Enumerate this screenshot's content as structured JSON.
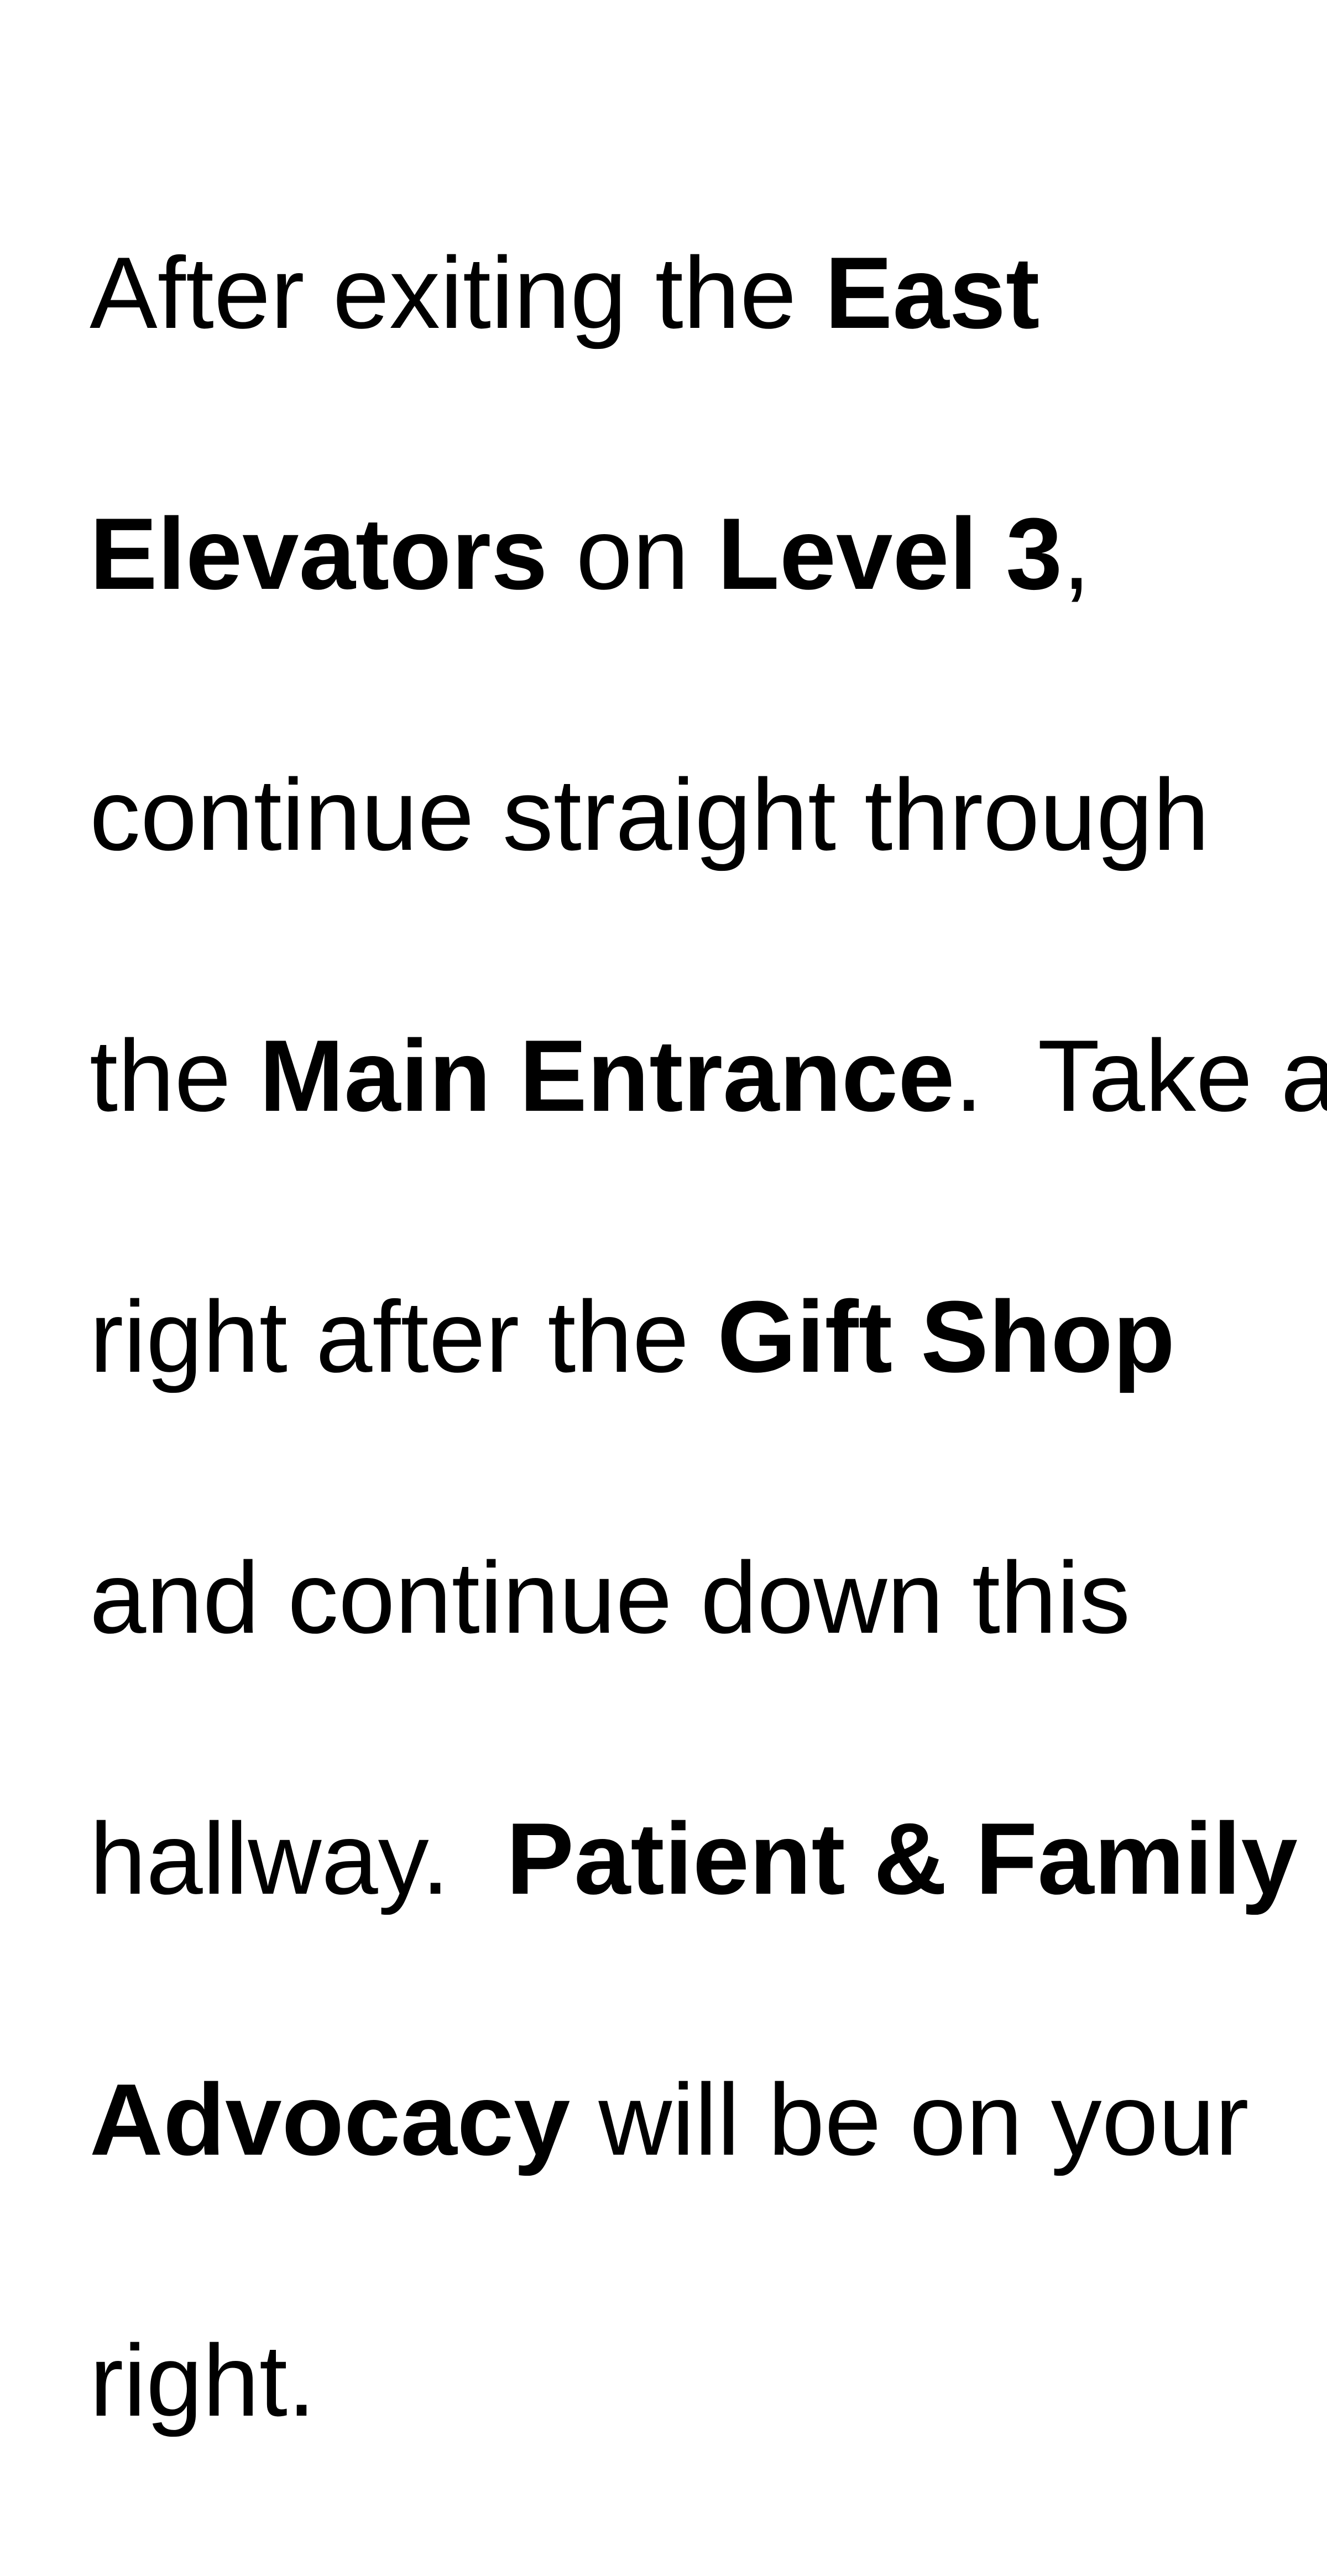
{
  "document": {
    "lines": [
      [
        {
          "text": "After exiting the ",
          "bold": false
        },
        {
          "text": "East",
          "bold": true
        }
      ],
      [
        {
          "text": "Elevators",
          "bold": true
        },
        {
          "text": " on ",
          "bold": false
        },
        {
          "text": "Level 3",
          "bold": true
        },
        {
          "text": ",",
          "bold": false
        }
      ],
      [
        {
          "text": "continue straight through",
          "bold": false
        }
      ],
      [
        {
          "text": "the ",
          "bold": false
        },
        {
          "text": "Main Entrance",
          "bold": true
        },
        {
          "text": ".  Take a",
          "bold": false
        }
      ],
      [
        {
          "text": "right after the ",
          "bold": false
        },
        {
          "text": "Gift Shop",
          "bold": true
        }
      ],
      [
        {
          "text": "and continue down this",
          "bold": false
        }
      ],
      [
        {
          "text": "hallway.  ",
          "bold": false
        },
        {
          "text": "Patient & Family",
          "bold": true
        }
      ],
      [
        {
          "text": "Advocacy",
          "bold": true
        },
        {
          "text": " will be on your",
          "bold": false
        }
      ],
      [
        {
          "text": "right.",
          "bold": false
        }
      ]
    ],
    "colors": {
      "text": "#000000",
      "background": "#ffffff"
    }
  }
}
